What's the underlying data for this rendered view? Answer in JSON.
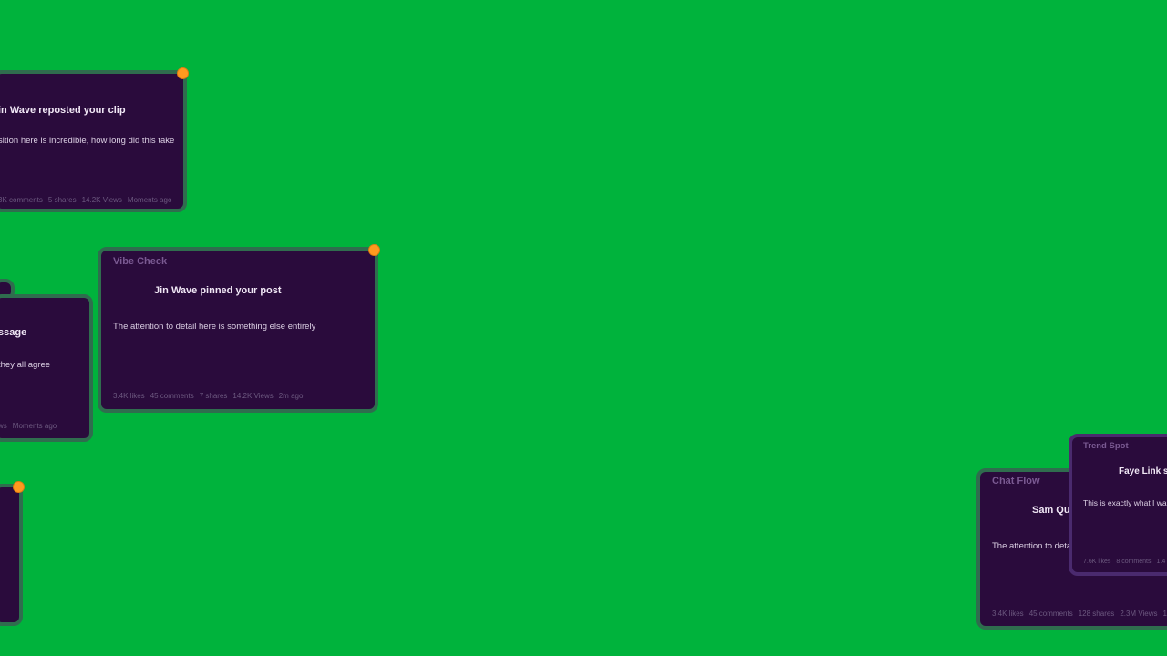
{
  "colors": {
    "background": "#00b33c",
    "card_bg": "#2a0b3c",
    "card_border": "#2f6d4e",
    "notification_dot": "#ff9a1f"
  },
  "cards": [
    {
      "id": "card-a",
      "brand": "",
      "headline": "in Wave  reposted your clip",
      "body": "sition here is incredible, how long did this take",
      "meta": [
        "3K comments",
        "5 shares",
        "14.2K Views",
        "Moments ago"
      ],
      "has_dot": true
    },
    {
      "id": "card-b",
      "brand": "Vibe Check",
      "headline": "Jin Wave  pinned your post",
      "body": "The attention to detail here is something else entirely",
      "meta": [
        "3.4K likes",
        "45 comments",
        "7 shares",
        "14.2K Views",
        "2m ago"
      ],
      "has_dot": true
    },
    {
      "id": "card-c",
      "brand": "",
      "headline": "ssage",
      "body": "they all agree",
      "meta": [
        "ws",
        "Moments ago"
      ],
      "has_dot": false
    },
    {
      "id": "card-d",
      "brand": "",
      "headline": "",
      "body": "",
      "meta": [],
      "has_dot": true
    },
    {
      "id": "card-e",
      "brand": "Chat Flow",
      "headline": "Sam Qu",
      "body": "The attention to deta",
      "meta": [
        "3.4K likes",
        "45 comments",
        "128 shares",
        "2.3M Views",
        "1"
      ],
      "has_dot": false
    },
    {
      "id": "card-f",
      "brand": "Trend Spot",
      "headline": "Faye Link  s",
      "body": "This is exactly what I wa",
      "meta": [
        "7.6K likes",
        "8 comments",
        "1.4"
      ],
      "has_dot": false
    }
  ]
}
